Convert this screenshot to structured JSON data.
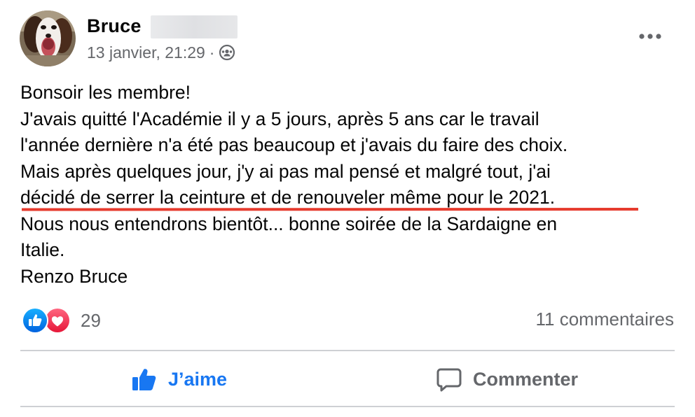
{
  "post": {
    "author": {
      "name": "Bruce"
    },
    "timestamp": "13 janvier, 21:29",
    "separator": "·",
    "privacy_icon": "group-icon",
    "more_icon": "more-options-icon",
    "body_lines": [
      "Bonsoir les membre!",
      "J'avais quitté l'Académie il y a 5 jours, après 5 ans car le travail",
      "l'année dernière n'a été pas beaucoup et j'avais du faire des choix.",
      "Mais après quelques jour, j'y ai pas mal pensé et malgré tout, j'ai",
      "décidé de serrer la ceinture et de renouveler même pour le 2021.",
      "Nous nous entendrons bientôt... bonne soirée de la Sardaigne en",
      "Italie.",
      "Renzo Bruce"
    ],
    "highlight_color": "#e63b2e",
    "reactions": {
      "icons": [
        "like-reaction-icon",
        "love-reaction-icon"
      ],
      "count": "29"
    },
    "comments_count": "11 commentaires",
    "actions": {
      "like_label": "J’aime",
      "comment_label": "Commenter"
    },
    "colors": {
      "like_blue": "#1877f2",
      "love_red": "#f33e58",
      "secondary_text": "#65676b"
    }
  }
}
